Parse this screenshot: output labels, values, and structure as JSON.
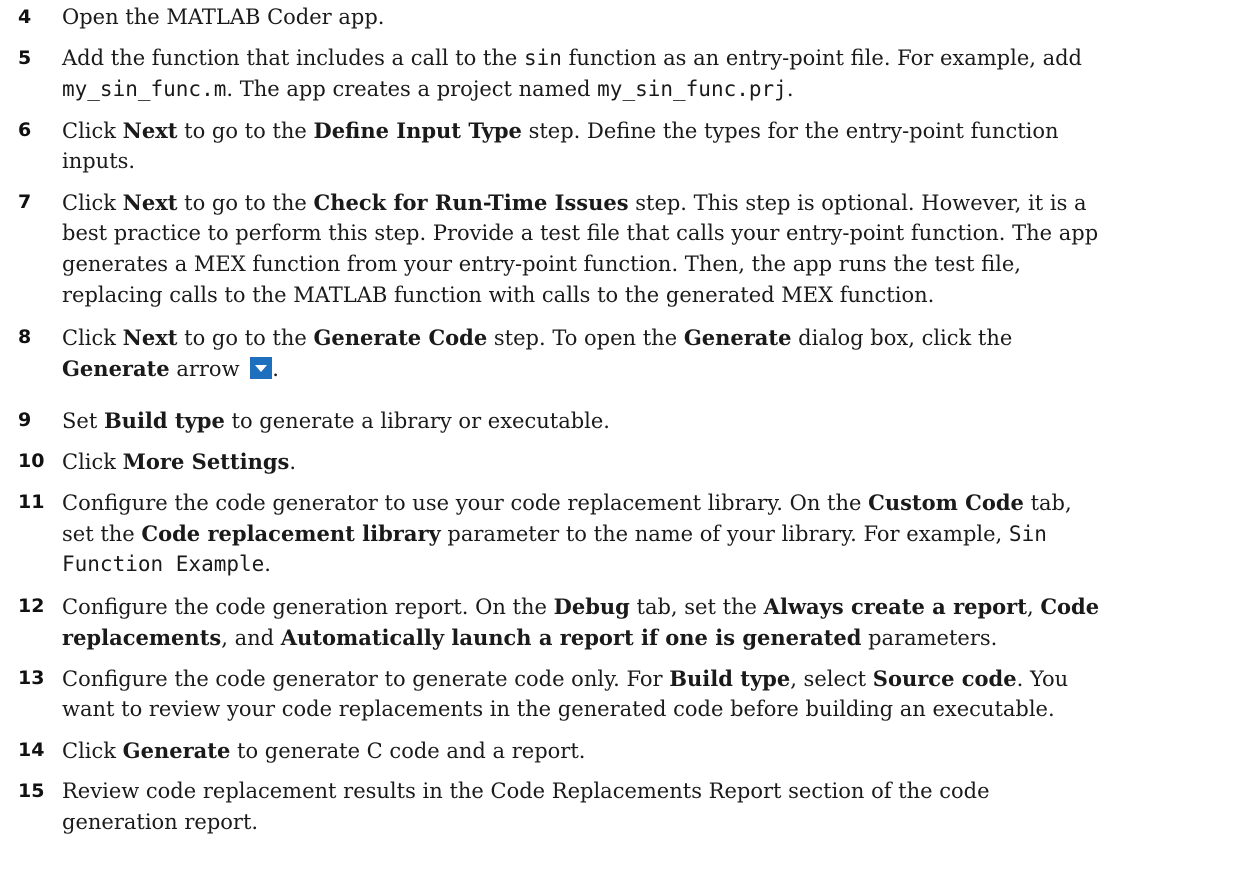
{
  "steps": [
    {
      "num": "4",
      "lines": [
        [
          {
            "t": "Open the MATLAB Coder app."
          }
        ]
      ]
    },
    {
      "num": "5",
      "lines": [
        [
          {
            "t": "Add the function that includes a call to the "
          },
          {
            "t": "sin",
            "s": "code"
          },
          {
            "t": " function as an entry-point file. For example, add"
          }
        ],
        [
          {
            "t": "my_sin_func.m",
            "s": "code"
          },
          {
            "t": ". The app creates a project named "
          },
          {
            "t": "my_sin_func.prj",
            "s": "code"
          },
          {
            "t": "."
          }
        ]
      ]
    },
    {
      "num": "6",
      "lines": [
        [
          {
            "t": "Click "
          },
          {
            "t": "Next",
            "s": "b"
          },
          {
            "t": " to go to the "
          },
          {
            "t": "Define Input Type",
            "s": "b"
          },
          {
            "t": " step. Define the types for the entry-point function"
          }
        ],
        [
          {
            "t": "inputs."
          }
        ]
      ]
    },
    {
      "num": "7",
      "lines": [
        [
          {
            "t": "Click "
          },
          {
            "t": "Next",
            "s": "b"
          },
          {
            "t": " to go to the "
          },
          {
            "t": "Check for Run-Time Issues",
            "s": "b"
          },
          {
            "t": " step. This step is optional. However, it is a"
          }
        ],
        [
          {
            "t": "best practice to perform this step. Provide a test file that calls your entry-point function. The app"
          }
        ],
        [
          {
            "t": "generates a MEX function from your entry-point function. Then, the app runs the test file,"
          }
        ],
        [
          {
            "t": "replacing calls to the MATLAB function with calls to the generated MEX function."
          }
        ]
      ]
    },
    {
      "num": "8",
      "lines": [
        [
          {
            "t": "Click "
          },
          {
            "t": "Next",
            "s": "b"
          },
          {
            "t": " to go to the "
          },
          {
            "t": "Generate Code",
            "s": "b"
          },
          {
            "t": " step. To open the "
          },
          {
            "t": "Generate",
            "s": "b"
          },
          {
            "t": " dialog box, click the"
          }
        ],
        [
          {
            "t": "Generate",
            "s": "b"
          },
          {
            "t": " arrow "
          },
          {
            "t": "generate-arrow-icon",
            "s": "icon"
          },
          {
            "t": "."
          }
        ]
      ]
    },
    {
      "num": "9",
      "lines": [
        [
          {
            "t": "Set "
          },
          {
            "t": "Build type",
            "s": "b"
          },
          {
            "t": " to generate a library or executable."
          }
        ]
      ]
    },
    {
      "num": "10",
      "lines": [
        [
          {
            "t": "Click "
          },
          {
            "t": "More Settings",
            "s": "b"
          },
          {
            "t": "."
          }
        ]
      ]
    },
    {
      "num": "11",
      "lines": [
        [
          {
            "t": "Configure the code generator to use your code replacement library. On the "
          },
          {
            "t": "Custom Code",
            "s": "b"
          },
          {
            "t": " tab,"
          }
        ],
        [
          {
            "t": "set the "
          },
          {
            "t": "Code replacement library",
            "s": "b"
          },
          {
            "t": " parameter to the name of your library. For example, "
          },
          {
            "t": "Sin",
            "s": "code"
          }
        ],
        [
          {
            "t": "Function Example",
            "s": "code"
          },
          {
            "t": "."
          }
        ]
      ]
    },
    {
      "num": "12",
      "lines": [
        [
          {
            "t": "Configure the code generation report. On the "
          },
          {
            "t": "Debug",
            "s": "b"
          },
          {
            "t": " tab, set the "
          },
          {
            "t": "Always create a report",
            "s": "b"
          },
          {
            "t": ", "
          },
          {
            "t": "Code",
            "s": "b"
          }
        ],
        [
          {
            "t": "replacements",
            "s": "b"
          },
          {
            "t": ", and "
          },
          {
            "t": "Automatically launch a report if one is generated",
            "s": "b"
          },
          {
            "t": " parameters."
          }
        ]
      ]
    },
    {
      "num": "13",
      "lines": [
        [
          {
            "t": "Configure the code generator to generate code only. For "
          },
          {
            "t": "Build type",
            "s": "b"
          },
          {
            "t": ", select "
          },
          {
            "t": "Source code",
            "s": "b"
          },
          {
            "t": ". You"
          }
        ],
        [
          {
            "t": "want to review your code replacements in the generated code before building an executable."
          }
        ]
      ]
    },
    {
      "num": "14",
      "lines": [
        [
          {
            "t": "Click "
          },
          {
            "t": "Generate",
            "s": "b"
          },
          {
            "t": " to generate C code and a report."
          }
        ]
      ]
    },
    {
      "num": "15",
      "lines": [
        [
          {
            "t": "Review code replacement results in the Code Replacements Report section of the code"
          }
        ],
        [
          {
            "t": "generation report."
          }
        ]
      ]
    }
  ]
}
